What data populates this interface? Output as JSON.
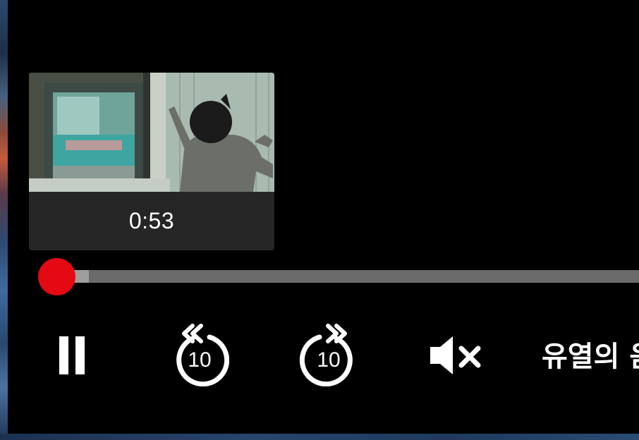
{
  "player": {
    "preview": {
      "time": "0:53"
    },
    "progress": {
      "played_fraction": 0.0,
      "buffered_fraction": 0.056
    },
    "controls": {
      "pause": "pause-icon",
      "rewind": {
        "icon": "replay-10-icon",
        "label": "10"
      },
      "forward": {
        "icon": "forward-10-icon",
        "label": "10"
      },
      "volume": "volume-muted-icon"
    },
    "title": "유열의 음"
  },
  "colors": {
    "accent": "#e50914",
    "track": "#6b6b6b",
    "buffered": "#9e9e9e",
    "background": "#000000",
    "card": "#262626"
  }
}
